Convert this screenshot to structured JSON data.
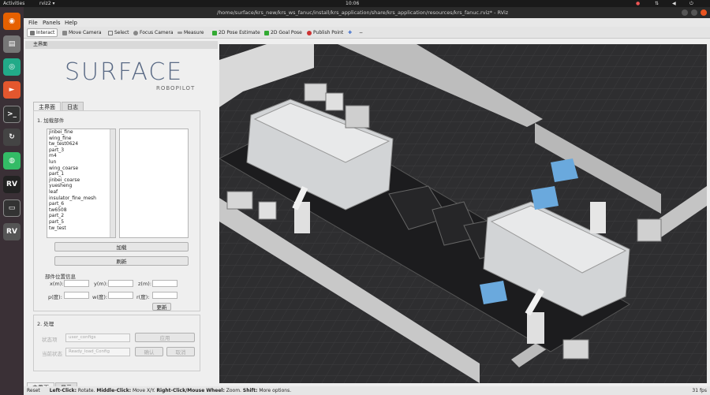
{
  "topbar": {
    "activities": "Activities",
    "app": "rviz2 ▾",
    "clock": "10:06"
  },
  "window": {
    "title": "/home/surface/krs_new/krs_ws_fanuc/install/krs_application/share/krs_application/resources/krs_fanuc.rviz* - RViz"
  },
  "menu": {
    "file": "File",
    "panels": "Panels",
    "help": "Help"
  },
  "toolbar": {
    "interact": "Interact",
    "move_camera": "Move Camera",
    "select": "Select",
    "focus_camera": "Focus Camera",
    "measure": "Measure",
    "pose_estimate": "2D Pose Estimate",
    "goal_pose": "2D Goal Pose",
    "publish_point": "Publish Point"
  },
  "panel": {
    "header": "主界面",
    "logo": "SURFACE",
    "logo_sub": "ROBOPILOT",
    "tabs": [
      "主界面",
      "日志"
    ],
    "section1": "1. 加载部件",
    "parts": [
      "jinbei_fine",
      "wing_fine",
      "tw_test0624",
      "part_3",
      "m4",
      "lun",
      "wing_coarse",
      "part_1",
      "jinbei_coarse",
      "yuesheng",
      "leaf",
      "insulator_fine_mesh",
      "part_6",
      "tw6508",
      "part_2",
      "part_5",
      "tw_test"
    ],
    "load_button": "加载",
    "refresh_button": "刷新",
    "pose_title": "部件位置信息",
    "x_label": "x(m):",
    "y_label": "y(m):",
    "z_label": "z(m):",
    "p_label": "p(度):",
    "w_label": "w(度):",
    "r_label": "r(度):",
    "update_button": "更新",
    "section2": "2. 处理",
    "state_label": "状态项",
    "state_value": "user_configs",
    "apply_button": "应用",
    "current_label": "当前状态",
    "current_value": "Ready_load_Config",
    "confirm_button": "确认",
    "cancel_button": "取消",
    "bottom_tabs": [
      "主界面",
      "显示"
    ]
  },
  "status": {
    "reset": "Reset",
    "hint_left": "Left-Click:",
    "hint_left_v": " Rotate. ",
    "hint_mid": "Middle-Click:",
    "hint_mid_v": " Move X/Y. ",
    "hint_right": "Right-Click/Mouse Wheel:",
    "hint_right_v": " Zoom. ",
    "hint_shift": "Shift:",
    "hint_shift_v": " More options.",
    "fps": "31 fps"
  },
  "colors": {
    "accent_blue": "#6aa9dd",
    "logo": "#5a6a85",
    "floor": "#2e2e30"
  }
}
